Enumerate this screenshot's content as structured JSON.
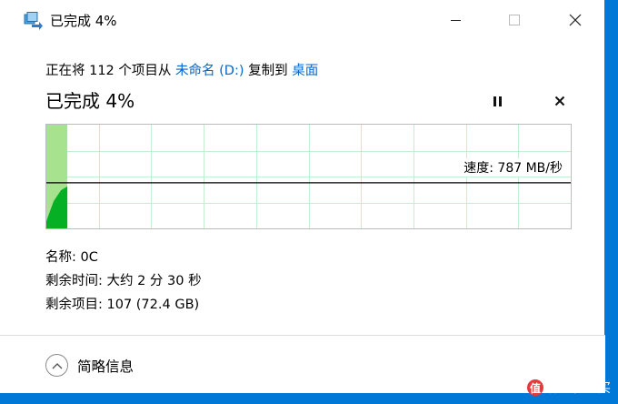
{
  "window": {
    "title": "已完成 4%"
  },
  "copy": {
    "prefix": "正在将 112 个项目从 ",
    "source": "未命名 (D:)",
    "middle": " 复制到 ",
    "destination": "桌面"
  },
  "progress": {
    "title": "已完成 4%",
    "percent": 4,
    "speed_label": "速度: 787 MB/秒"
  },
  "details": {
    "name": "名称: 0C",
    "time_remaining": "剩余时间: 大约 2 分 30 秒",
    "items_remaining": "剩余项目: 107 (72.4 GB)"
  },
  "footer": {
    "less_details_label": "简略信息"
  },
  "watermark": {
    "text": "什么值得买"
  },
  "colors": {
    "graph_fill": "#06b025",
    "graph_fill_light": "#a7e28f",
    "grid": "#c6efcf",
    "link": "#0066cc",
    "desktop": "#0078d7"
  }
}
